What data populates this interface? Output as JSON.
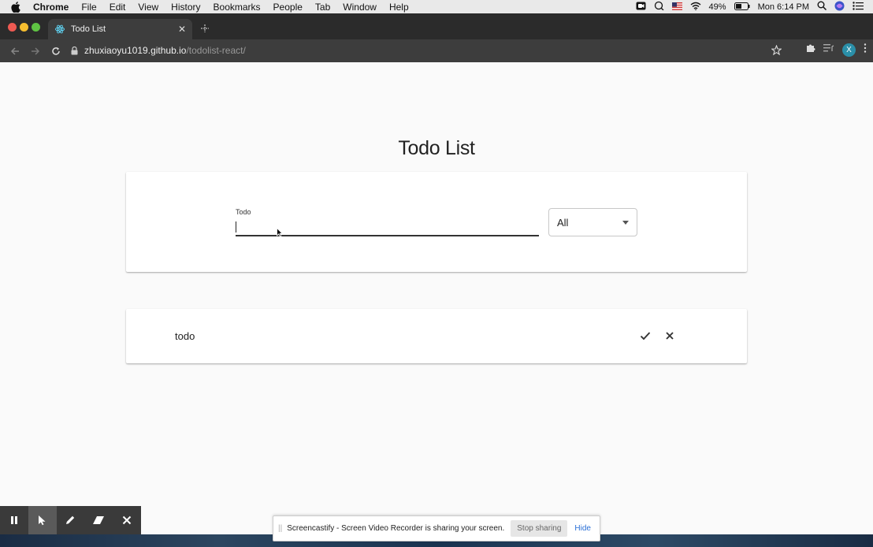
{
  "menubar": {
    "app_name": "Chrome",
    "items": [
      "File",
      "Edit",
      "View",
      "History",
      "Bookmarks",
      "People",
      "Tab",
      "Window",
      "Help"
    ],
    "battery": "49%",
    "clock": "Mon 6:14 PM"
  },
  "browser": {
    "tab_title": "Todo List",
    "url_host": "zhuxiaoyu1019.github.io",
    "url_path": "/todolist-react/",
    "profile_initial": "X"
  },
  "page": {
    "title": "Todo List",
    "form": {
      "input_label": "Todo",
      "input_value": "",
      "filter_value": "All"
    },
    "todos": [
      {
        "text": "todo"
      }
    ]
  },
  "screencastify": {
    "message": "Screencastify - Screen Video Recorder is sharing your screen.",
    "stop_label": "Stop sharing",
    "hide_label": "Hide"
  },
  "colors": {
    "page_bg": "#fafafa",
    "card_bg": "#ffffff",
    "link_blue": "#2a6fd6",
    "chrome_dark": "#3d3d3d"
  }
}
